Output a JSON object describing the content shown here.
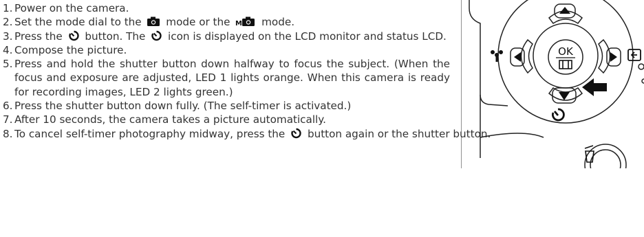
{
  "steps": [
    {
      "num": "1.",
      "text": "Power on the camera."
    },
    {
      "num": "2.",
      "pre": "Set the mode dial to the",
      "mid": "mode or the",
      "post": "mode."
    },
    {
      "num": "3.",
      "pre": "Press the",
      "mid": "button. The",
      "post": "icon is displayed on the LCD monitor and status LCD."
    },
    {
      "num": "4.",
      "text": "Compose the picture."
    },
    {
      "num": "5.",
      "text": "Press and hold the shutter button down halfway to focus the subject. (When the focus and exposure are adjusted, LED 1 lights orange. When this camera is ready for recording images, LED 2 lights green.)"
    },
    {
      "num": "6.",
      "text": "Press the shutter button down fully. (The self-timer is activated.)"
    },
    {
      "num": "7.",
      "text": "After 10 seconds, the camera takes a picture automatically."
    },
    {
      "num": "8.",
      "pre": "To cancel self-timer photography midway, press the",
      "post": "button again or the shutter button."
    }
  ],
  "icons": {
    "camera": "camera-mode-icon",
    "manual": "manual-camera-mode-icon",
    "timer": "self-timer-icon"
  },
  "figure": {
    "ok_label": "OK",
    "arrow_hint": "pointer-arrow",
    "colors": {
      "line": "#222222",
      "arrow": "#111111"
    }
  }
}
